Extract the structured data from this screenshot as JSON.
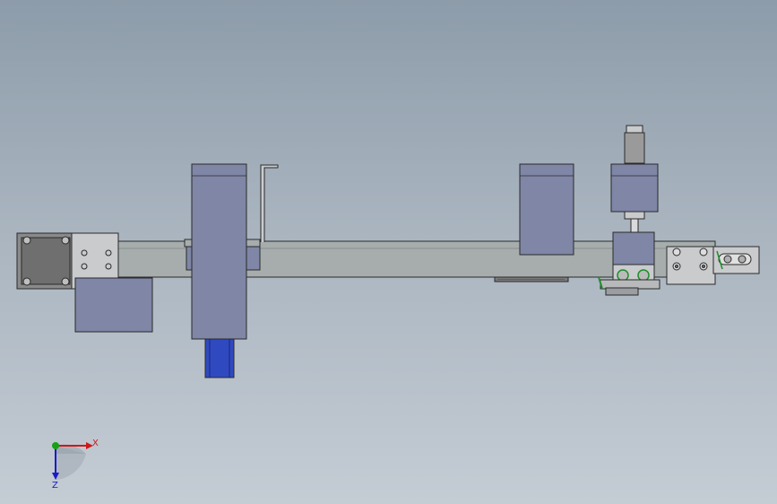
{
  "app": {
    "view": "cad-model-viewport"
  },
  "triad": {
    "x_label": "X",
    "z_label": "Z",
    "x_color": "#d01818",
    "z_color": "#1a1ac8",
    "y_color": "#18a018"
  },
  "colors": {
    "beam": "#a7adad",
    "housing": "#7f86a6",
    "motor_dark": "#6f6f6f",
    "bracket": "#c9cbcd",
    "blue_part": "#2f49c0",
    "accent_green": "#1e8f2a",
    "outline": "#2a2a2a"
  }
}
